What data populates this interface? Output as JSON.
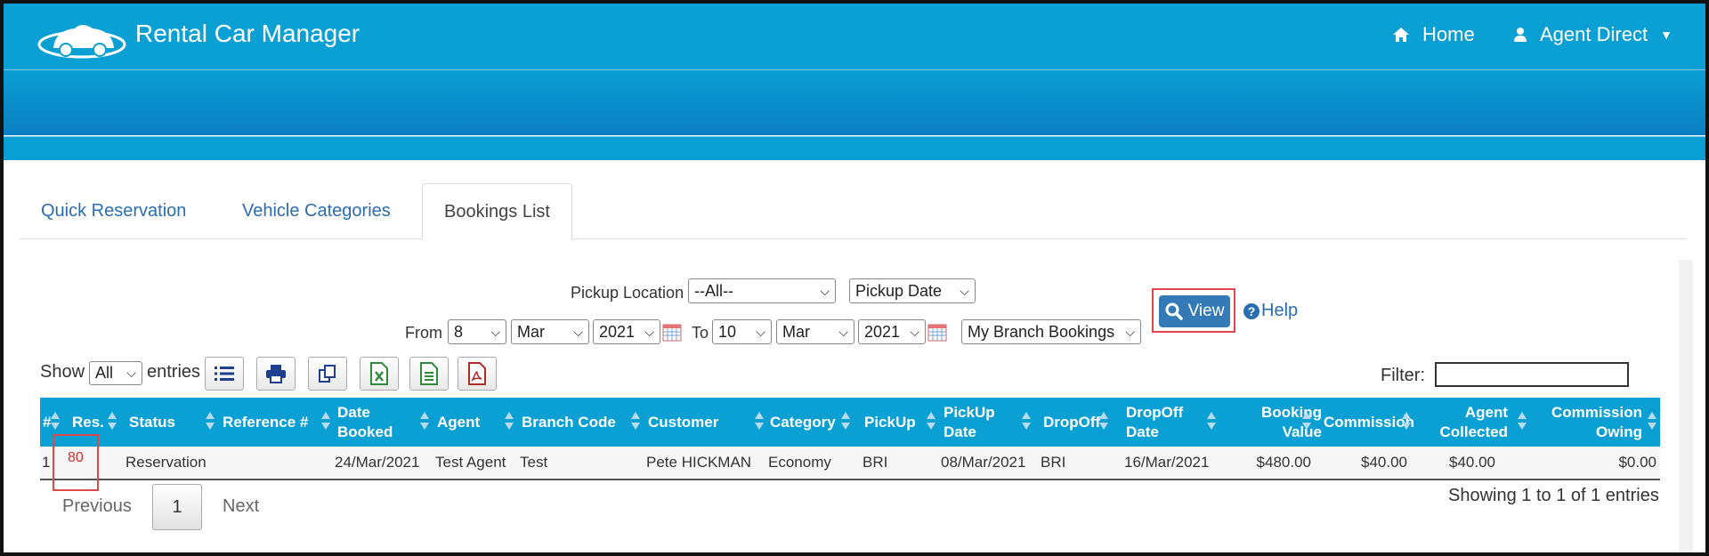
{
  "header": {
    "app_title": "Rental Car Manager",
    "home_label": "Home",
    "user_label": "Agent Direct"
  },
  "tabs": [
    {
      "label": "Quick Reservation"
    },
    {
      "label": "Vehicle Categories"
    },
    {
      "label": "Bookings List",
      "active": true
    }
  ],
  "filters": {
    "pickup_location_label": "Pickup Location",
    "pickup_location_value": "--All--",
    "date_type_value": "Pickup Date",
    "from_label": "From",
    "from_day": "8",
    "from_month": "Mar",
    "from_year": "2021",
    "to_label": "To",
    "to_day": "10",
    "to_month": "Mar",
    "to_year": "2021",
    "scope_value": "My Branch Bookings",
    "view_button": "View",
    "help_label": "Help"
  },
  "table_controls": {
    "show_label": "Show",
    "show_value": "All",
    "entries_label": "entries",
    "filter_label": "Filter:",
    "toolbar_icons": [
      "list-icon",
      "print-icon",
      "copy-icon",
      "excel-icon",
      "csv-icon",
      "pdf-icon"
    ]
  },
  "table": {
    "columns": [
      "#",
      "Res.",
      "Status",
      "Reference #",
      "Date Booked",
      "Agent",
      "Branch Code",
      "Customer",
      "Category",
      "PickUp",
      "PickUp Date",
      "DropOff",
      "DropOff Date",
      "Booking Value",
      "Commission",
      "Agent Collected",
      "Commission Owing"
    ],
    "rows": [
      [
        "1",
        "80",
        "Reservation",
        "",
        "24/Mar/2021",
        "Test Agent",
        "Test",
        "Pete HICKMAN",
        "Economy",
        "BRI",
        "08/Mar/2021",
        "BRI",
        "16/Mar/2021",
        "$480.00",
        "$40.00",
        "$40.00",
        "$0.00"
      ]
    ]
  },
  "pagination": {
    "previous": "Previous",
    "current_page": "1",
    "next": "Next",
    "summary": "Showing 1 to 1 of 1 entries"
  },
  "colors": {
    "header_blue": "#0aa0d4",
    "link_blue": "#2a6db0",
    "button_blue": "#337ab7",
    "highlight_red": "#e0474c"
  }
}
